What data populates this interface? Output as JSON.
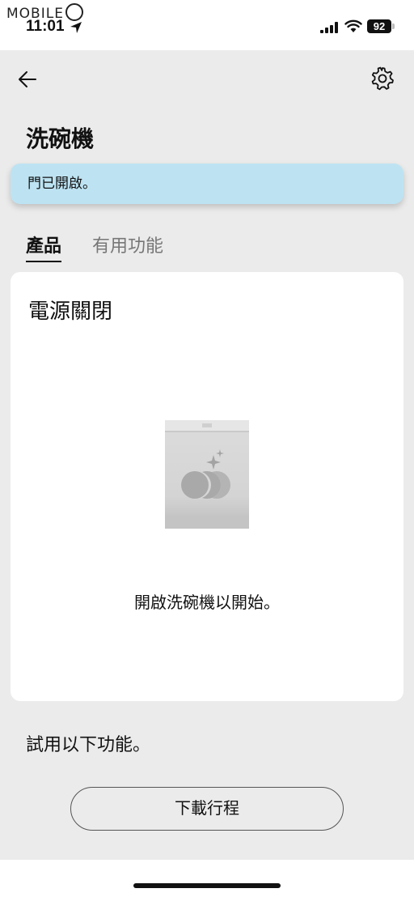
{
  "status_bar": {
    "watermark": "MOBILE",
    "time": "11:01",
    "battery": "92"
  },
  "header": {
    "title": "洗碗機"
  },
  "banner": {
    "text": "門已開啟。"
  },
  "tabs": [
    {
      "label": "產品",
      "active": true
    },
    {
      "label": "有用功能",
      "active": false
    }
  ],
  "card": {
    "power_status": "電源關閉",
    "hint": "開啟洗碗機以開始。"
  },
  "features": {
    "heading": "試用以下功能。",
    "download_button": "下載行程"
  },
  "colors": {
    "background": "#ebebeb",
    "banner": "#bde3f2",
    "card": "#ffffff"
  },
  "icons": [
    "back-arrow-icon",
    "gear-icon",
    "location-arrow-icon",
    "signal-icon",
    "wifi-icon",
    "dishwasher-icon"
  ]
}
